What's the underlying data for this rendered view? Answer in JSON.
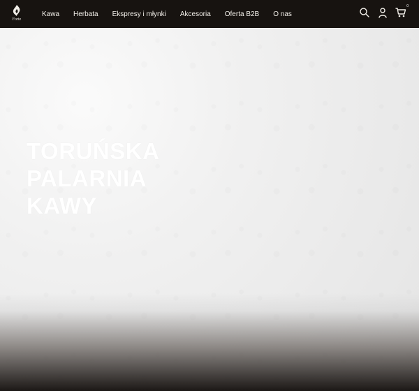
{
  "brand": {
    "name": "Forte"
  },
  "nav": {
    "items": [
      {
        "label": "Kawa"
      },
      {
        "label": "Herbata"
      },
      {
        "label": "Ekspresy i młynki"
      },
      {
        "label": "Akcesoria"
      },
      {
        "label": "Oferta B2B"
      },
      {
        "label": "O nas"
      }
    ]
  },
  "header_icons": {
    "search": "search-icon",
    "user": "user-icon",
    "cart": "cart-icon",
    "cart_count": "0"
  },
  "hero": {
    "title": "TORUŃSKA\nPALARNIA\nKAWY"
  },
  "colors": {
    "header_bg": "#171310",
    "hero_text": "#ffffff"
  }
}
